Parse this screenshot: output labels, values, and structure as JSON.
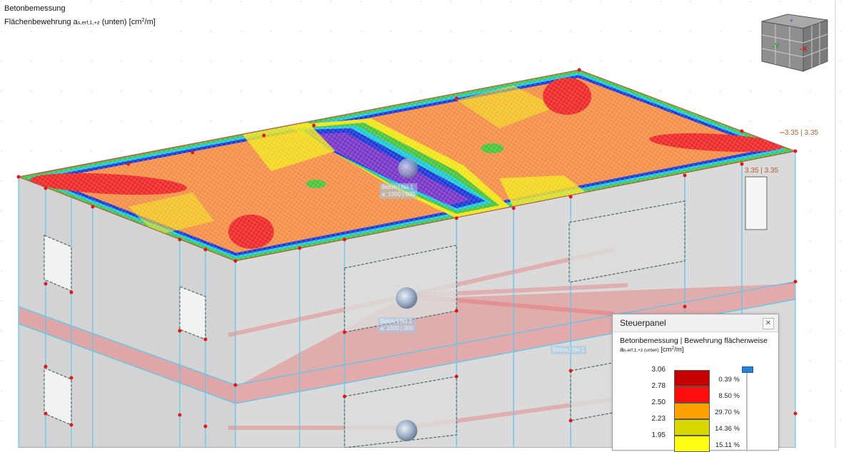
{
  "viewport": {
    "title_line1": "Betonbemessung",
    "title_line2_prefix": "Flächenbewehrung a",
    "title_line2_subscript": "s,erf,1,+z",
    "title_line2_mid": " (unten) [cm",
    "title_line2_sup": "2",
    "title_line2_suffix": "/m]",
    "dimension_label_1": "3.35 | 3.35",
    "dimension_label_2": "3.35 | 3.35",
    "node_labels": [
      {
        "line1": "Beton | No 1",
        "line2": "a: 1000 | 000"
      },
      {
        "line1": "Beton | No 1",
        "line2": "a: 1000 | 000"
      },
      {
        "line1": "Beton | No 1",
        "line2": ""
      }
    ]
  },
  "navcube": {
    "axis_neg_y": "-Y",
    "axis_neg_x": "-X",
    "colors": {
      "neg_y": "#3a9a3a",
      "neg_x": "#d22020",
      "face": "#8f8f8f",
      "face_dark": "#6e6e6e"
    }
  },
  "control_panel": {
    "title": "Steuerpanel",
    "close_icon": "close-icon",
    "heading": "Betonbemessung | Bewehrung flächenweise",
    "quantity_prefix": "a",
    "quantity_subscript": "s,erf,1,+z (unten)",
    "quantity_unit_prefix": " [cm",
    "quantity_unit_sup": "2",
    "quantity_unit_suffix": "/m]",
    "legend": [
      {
        "value": "3.06",
        "color": "#c40000",
        "percent": "0.39 %"
      },
      {
        "value": "2.78",
        "color": "#ff0d0d",
        "percent": "8.50 %"
      },
      {
        "value": "2.50",
        "color": "#ffa200",
        "percent": "29.70 %"
      },
      {
        "value": "2.23",
        "color": "#d8d800",
        "percent": "14.36 %"
      },
      {
        "value": "1.95",
        "color": "#ffff14",
        "percent": "15.11 %"
      }
    ]
  },
  "colors": {
    "slab_red": "#ef2a2a",
    "slab_orange": "#f5904a",
    "slab_yellow": "#f2e41c",
    "slab_green": "#4cc43c",
    "slab_cyan": "#22c8d6",
    "slab_blue": "#1e3ad8",
    "slab_purple": "#7a38c8",
    "wall": "#d4d4d4",
    "frame_line": "#5cc8f0",
    "node_dot": "#e01818"
  }
}
